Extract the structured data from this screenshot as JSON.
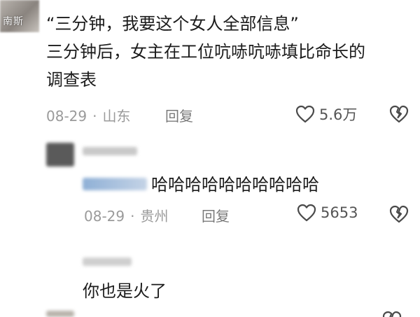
{
  "watermark": "南斯",
  "comment1": {
    "lines": [
      "“三分钟，我要这个女人全部信息”",
      "三分钟后，女主在工位吭哧吭哧填比命长的",
      "调查表"
    ],
    "date": "08-29",
    "location": "山东",
    "reply_label": "回复",
    "likes": "5.6万"
  },
  "reply1": {
    "text": "哈哈哈哈哈哈哈哈哈哈",
    "date": "08-29",
    "location": "贵州",
    "reply_label": "回复",
    "likes": "5653"
  },
  "comment3": {
    "text": "你也是火了"
  },
  "separator": "·",
  "icons": {
    "like": "heart-outline-icon",
    "dislike": "broken-heart-icon"
  },
  "colors": {
    "meta": "#9a9a9a",
    "text": "#1b1b1b",
    "icon": "#555555"
  }
}
